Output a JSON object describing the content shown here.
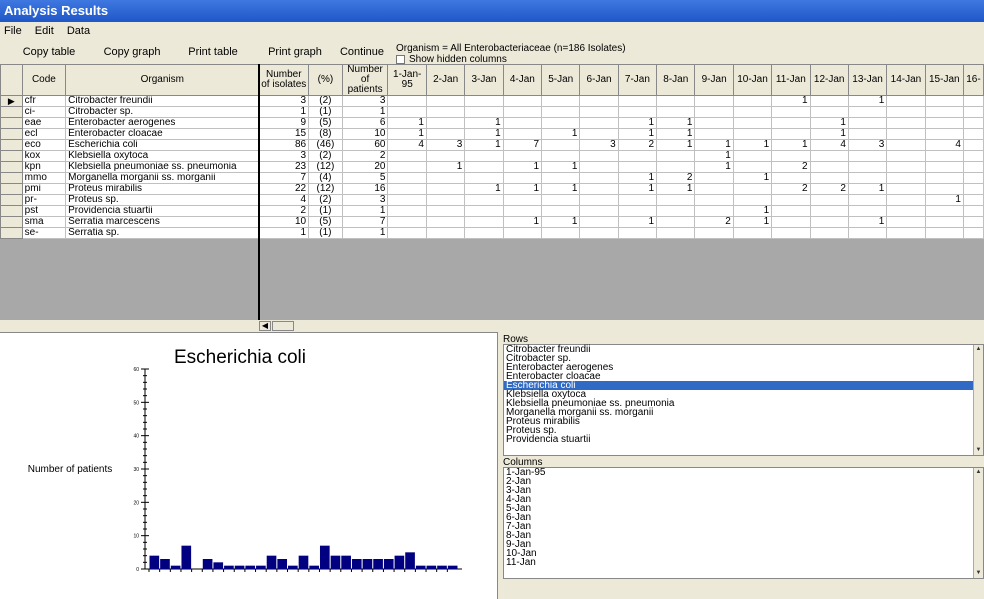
{
  "window": {
    "title": "Analysis Results"
  },
  "menu": [
    "File",
    "Edit",
    "Data"
  ],
  "toolbar": {
    "buttons": [
      "Copy table",
      "Copy graph",
      "Print table",
      "Print graph",
      "Continue"
    ],
    "organism_info": "Organism = All Enterobacteriaceae   (n=186 Isolates)",
    "show_hidden": "Show hidden columns"
  },
  "table": {
    "headers": [
      "Code",
      "Organism",
      "Number of isolates",
      "(%)",
      "Number of patients",
      "1-Jan-95",
      "2-Jan",
      "3-Jan",
      "4-Jan",
      "5-Jan",
      "6-Jan",
      "7-Jan",
      "8-Jan",
      "9-Jan",
      "10-Jan",
      "11-Jan",
      "12-Jan",
      "13-Jan",
      "14-Jan",
      "15-Jan",
      "16-"
    ],
    "rows": [
      [
        "cfr",
        "Citrobacter freundii",
        "3",
        "(2)",
        "3",
        "",
        "",
        "",
        "",
        "",
        "",
        "",
        "",
        "",
        "",
        "1",
        "",
        "1",
        "",
        "",
        ""
      ],
      [
        "ci-",
        "Citrobacter sp.",
        "1",
        "(1)",
        "1",
        "",
        "",
        "",
        "",
        "",
        "",
        "",
        "",
        "",
        "",
        "",
        "",
        "",
        "",
        "",
        ""
      ],
      [
        "eae",
        "Enterobacter aerogenes",
        "9",
        "(5)",
        "6",
        "1",
        "",
        "1",
        "",
        "",
        "",
        "1",
        "1",
        "",
        "",
        "",
        "1",
        "",
        "",
        "",
        ""
      ],
      [
        "ecl",
        "Enterobacter cloacae",
        "15",
        "(8)",
        "10",
        "1",
        "",
        "1",
        "",
        "1",
        "",
        "1",
        "1",
        "",
        "",
        "",
        "1",
        "",
        "",
        "",
        ""
      ],
      [
        "eco",
        "Escherichia coli",
        "86",
        "(46)",
        "60",
        "4",
        "3",
        "1",
        "7",
        "",
        "3",
        "2",
        "1",
        "1",
        "1",
        "1",
        "4",
        "3",
        "",
        "4",
        ""
      ],
      [
        "kox",
        "Klebsiella oxytoca",
        "3",
        "(2)",
        "2",
        "",
        "",
        "",
        "",
        "",
        "",
        "",
        "",
        "1",
        "",
        "",
        "",
        "",
        "",
        "",
        ""
      ],
      [
        "kpn",
        "Klebsiella pneumoniae ss. pneumonia",
        "23",
        "(12)",
        "20",
        "",
        "1",
        "",
        "1",
        "1",
        "",
        "",
        "",
        "1",
        "",
        "2",
        "",
        "",
        "",
        "",
        ""
      ],
      [
        "mmo",
        "Morganella morganii ss. morganii",
        "7",
        "(4)",
        "5",
        "",
        "",
        "",
        "",
        "",
        "",
        "1",
        "2",
        "",
        "1",
        "",
        "",
        "",
        "",
        "",
        ""
      ],
      [
        "pmi",
        "Proteus mirabilis",
        "22",
        "(12)",
        "16",
        "",
        "",
        "1",
        "1",
        "1",
        "",
        "1",
        "1",
        "",
        "",
        "2",
        "2",
        "1",
        "",
        "",
        ""
      ],
      [
        "pr-",
        "Proteus sp.",
        "4",
        "(2)",
        "3",
        "",
        "",
        "",
        "",
        "",
        "",
        "",
        "",
        "",
        "",
        "",
        "",
        "",
        "",
        "1",
        ""
      ],
      [
        "pst",
        "Providencia stuartii",
        "2",
        "(1)",
        "1",
        "",
        "",
        "",
        "",
        "",
        "",
        "",
        "",
        "",
        "1",
        "",
        "",
        "",
        "",
        "",
        ""
      ],
      [
        "sma",
        "Serratia marcescens",
        "10",
        "(5)",
        "7",
        "",
        "",
        "",
        "1",
        "1",
        "",
        "1",
        "",
        "2",
        "1",
        "",
        "",
        "1",
        "",
        "",
        ""
      ],
      [
        "se-",
        "Serratia sp.",
        "1",
        "(1)",
        "1",
        "",
        "",
        "",
        "",
        "",
        "",
        "",
        "",
        "",
        "",
        "",
        "",
        "",
        "",
        "",
        ""
      ]
    ]
  },
  "chart_data": {
    "type": "bar",
    "title": "Escherichia coli",
    "ylabel": "Number of patients",
    "xlabel": "",
    "ylim": [
      0,
      60
    ],
    "yticks": [
      "0",
      "10",
      "20",
      "30",
      "40",
      "50",
      "60"
    ],
    "values": [
      4,
      3,
      1,
      7,
      0,
      3,
      2,
      1,
      1,
      1,
      1,
      4,
      3,
      1,
      4,
      1,
      7,
      4,
      4,
      3,
      3,
      3,
      3,
      4,
      5,
      1,
      1,
      1,
      1
    ]
  },
  "rows_list": {
    "label": "Rows",
    "items": [
      "Citrobacter freundii",
      "Citrobacter sp.",
      "Enterobacter aerogenes",
      "Enterobacter cloacae",
      "Escherichia coli",
      "Klebsiella oxytoca",
      "Klebsiella pneumoniae ss. pneumonia",
      "Morganella morganii ss. morganii",
      "Proteus mirabilis",
      "Proteus sp.",
      "Providencia stuartii"
    ],
    "selected": 4
  },
  "cols_list": {
    "label": "Columns",
    "items": [
      "1-Jan-95",
      "2-Jan",
      "3-Jan",
      "4-Jan",
      "5-Jan",
      "6-Jan",
      "7-Jan",
      "8-Jan",
      "9-Jan",
      "10-Jan",
      "11-Jan"
    ]
  },
  "colors": {
    "bar": "#000080",
    "selection": "#316ac5",
    "title_bar": "#2a63d0"
  }
}
